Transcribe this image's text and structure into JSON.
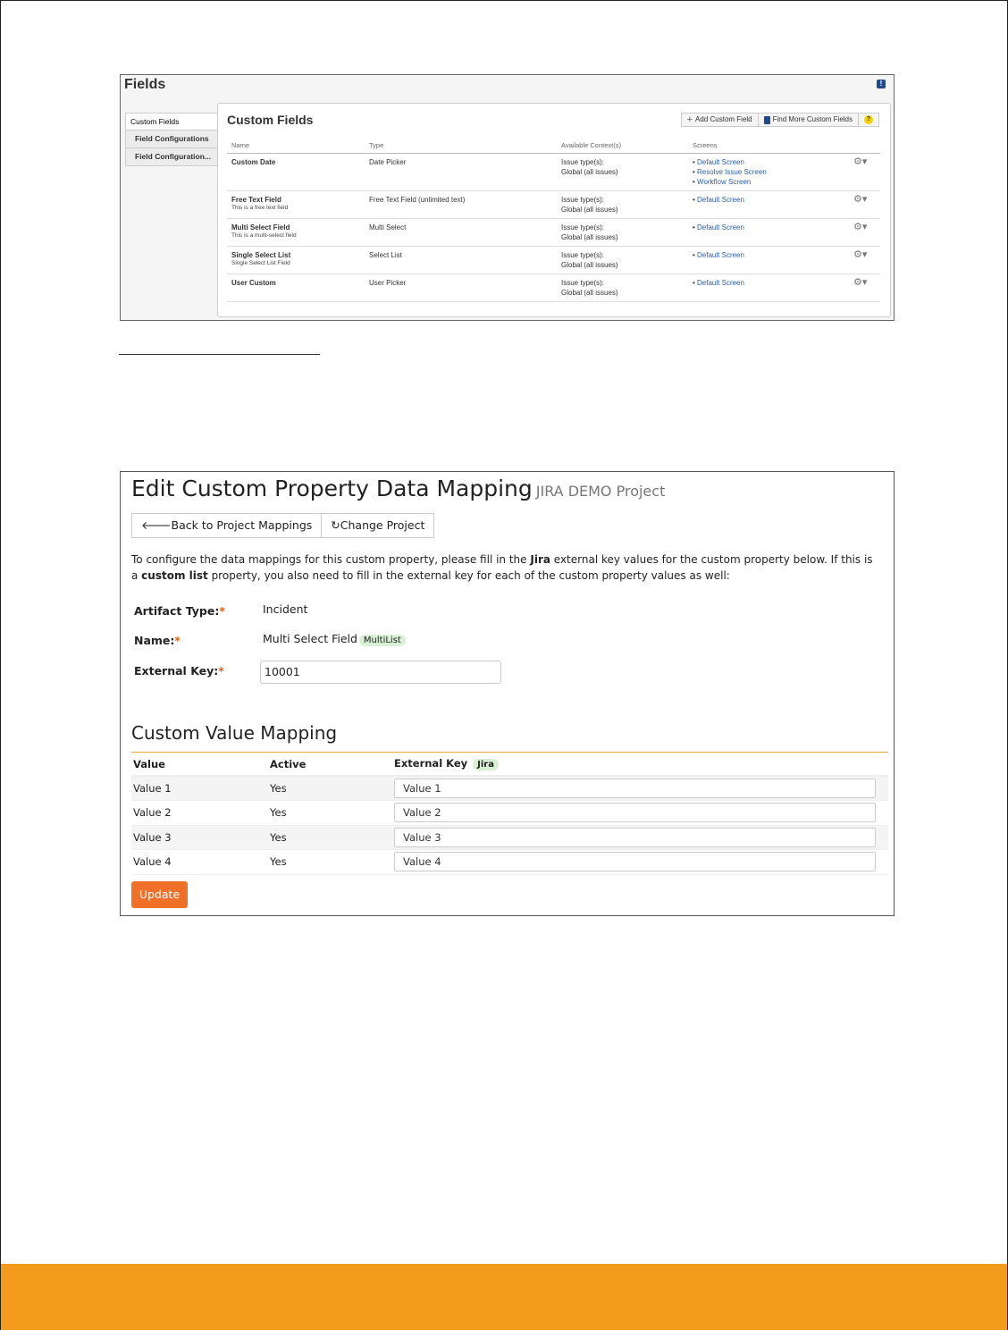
{
  "fields_screen": {
    "title": "Fields",
    "sidebar": [
      {
        "label": "Custom Fields"
      },
      {
        "label": "Field Configurations"
      },
      {
        "label": "Field Configuration..."
      }
    ],
    "panel_title": "Custom Fields",
    "buttons": {
      "add": "Add Custom Field",
      "find": "Find More Custom Fields"
    },
    "columns": [
      "Name",
      "Type",
      "Available Context(s)",
      "Screens"
    ],
    "rows": [
      {
        "name": "Custom Date",
        "desc": "",
        "type": "Date Picker",
        "context1": "Issue type(s):",
        "context2": "Global (all issues)",
        "screens": [
          "Default Screen",
          "Resolve Issue Screen",
          "Workflow Screen"
        ]
      },
      {
        "name": "Free Text Field",
        "desc": "This is a free text field",
        "type": "Free Text Field (unlimited text)",
        "context1": "Issue type(s):",
        "context2": "Global (all issues)",
        "screens": [
          "Default Screen"
        ]
      },
      {
        "name": "Multi Select Field",
        "desc": "This is a multi-select field",
        "type": "Multi Select",
        "context1": "Issue type(s):",
        "context2": "Global (all issues)",
        "screens": [
          "Default Screen"
        ]
      },
      {
        "name": "Single Select List",
        "desc": "Single Select List Field",
        "type": "Select List",
        "context1": "Issue type(s):",
        "context2": "Global (all issues)",
        "screens": [
          "Default Screen"
        ]
      },
      {
        "name": "User Custom",
        "desc": "",
        "type": "User Picker",
        "context1": "Issue type(s):",
        "context2": "Global (all issues)",
        "screens": [
          "Default Screen"
        ]
      }
    ]
  },
  "mapping_screen": {
    "title": "Edit Custom Property Data Mapping",
    "subtitle": "JIRA DEMO Project",
    "back_button": "Back to Project Mappings",
    "change_button": "Change Project",
    "intro_1": "To configure the data mappings for this custom property, please fill in the ",
    "intro_jira": "Jira",
    "intro_2": " external key values for the custom property below. If this is a ",
    "intro_list": "custom list",
    "intro_3": " property, you also need to fill in the external key for each of the custom property values as well:",
    "artifact_label": "Artifact Type:",
    "artifact_value": "Incident",
    "name_label": "Name:",
    "name_value": "Multi Select Field",
    "name_badge": "MultiList",
    "key_label": "External Key:",
    "key_value": "10001",
    "required_mark": "*",
    "section_title": "Custom Value Mapping",
    "columns": {
      "value": "Value",
      "active": "Active",
      "key": "External Key",
      "key_badge": "Jira"
    },
    "values": [
      {
        "value": "Value 1",
        "active": "Yes",
        "key": "Value 1"
      },
      {
        "value": "Value 2",
        "active": "Yes",
        "key": "Value 2"
      },
      {
        "value": "Value 3",
        "active": "Yes",
        "key": "Value 3"
      },
      {
        "value": "Value 4",
        "active": "Yes",
        "key": "Value 4"
      }
    ],
    "update_button": "Update"
  },
  "colors": {
    "accent_orange": "#f39c1c",
    "button_orange": "#f0702a",
    "link_blue": "#2a5db0"
  }
}
